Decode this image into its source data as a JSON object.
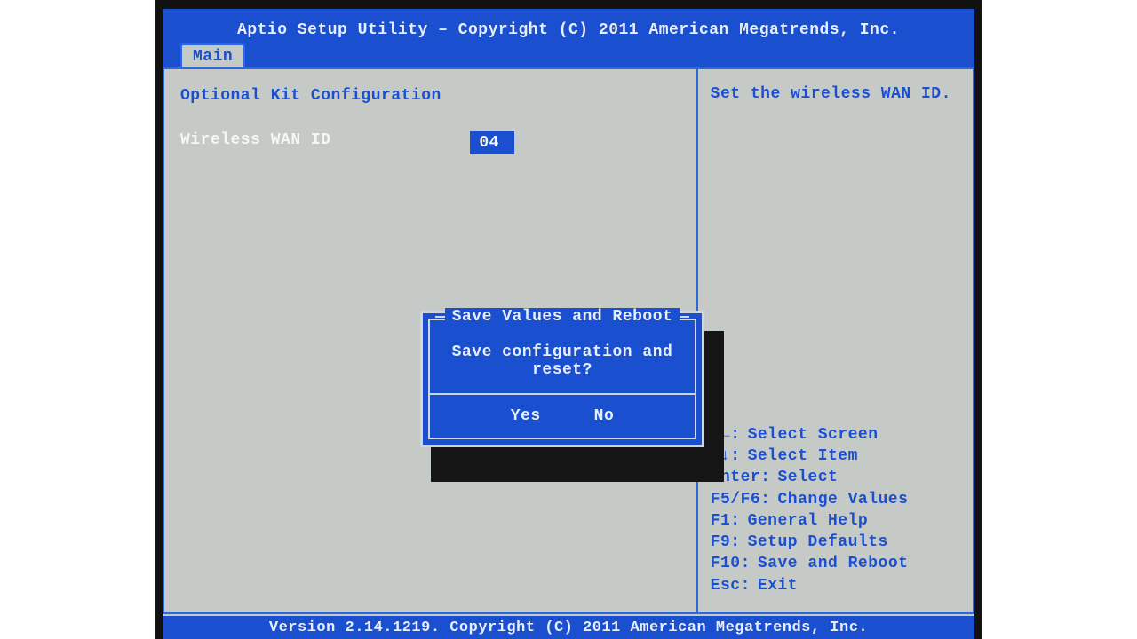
{
  "header": {
    "title": "Aptio Setup Utility – Copyright (C) 2011 American Megatrends, Inc.",
    "tabs": [
      {
        "label": "Main"
      }
    ]
  },
  "main": {
    "section_header": "Optional Kit Configuration",
    "setting": {
      "label": "Wireless WAN ID",
      "value": "04"
    }
  },
  "help": {
    "description": "Set the wireless WAN ID.",
    "keys": [
      {
        "key": "→←:",
        "action": "Select Screen"
      },
      {
        "key": "↑↓:",
        "action": "Select Item"
      },
      {
        "key": "Enter:",
        "action": "Select"
      },
      {
        "key": "F5/F6:",
        "action": "Change Values"
      },
      {
        "key": "F1:",
        "action": "General Help"
      },
      {
        "key": "F9:",
        "action": "Setup Defaults"
      },
      {
        "key": "F10:",
        "action": "Save and Reboot"
      },
      {
        "key": "Esc:",
        "action": "Exit"
      }
    ]
  },
  "dialog": {
    "title": "Save Values and Reboot",
    "message": "Save configuration and reset?",
    "yes": "Yes",
    "no": "No"
  },
  "footer": {
    "text": "Version 2.14.1219. Copyright (C) 2011 American Megatrends, Inc."
  }
}
